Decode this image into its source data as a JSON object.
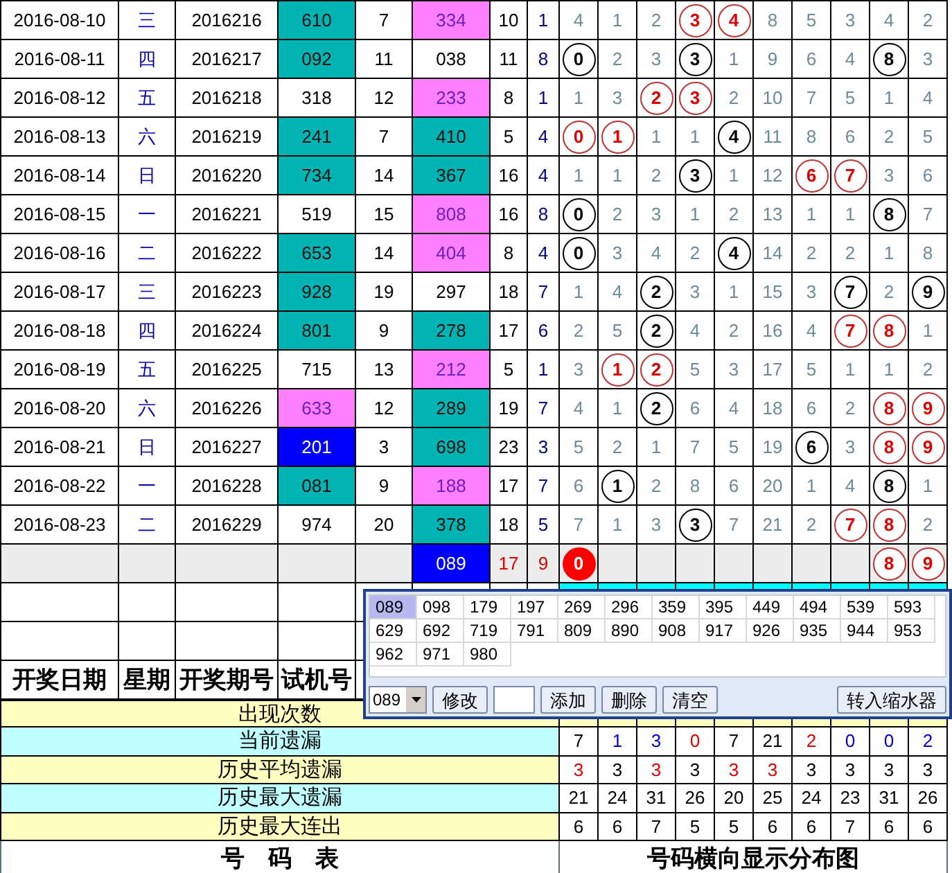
{
  "rows": [
    {
      "date": "2016-08-10",
      "weekday": "三",
      "issue": "2016216",
      "test": {
        "value": "610",
        "color": "#00b4b4"
      },
      "test_sum": "7",
      "draw": {
        "value": "334",
        "color": "#ff80ff"
      },
      "draw_sum": "10",
      "draw_tail": "1",
      "cells": [
        {
          "kind": "plain",
          "value": "4"
        },
        {
          "kind": "plain",
          "value": "1"
        },
        {
          "kind": "plain",
          "value": "2"
        },
        {
          "kind": "ring",
          "value": "3"
        },
        {
          "kind": "ring",
          "value": "4"
        },
        {
          "kind": "plain",
          "value": "8"
        },
        {
          "kind": "plain",
          "value": "5"
        },
        {
          "kind": "plain",
          "value": "3"
        },
        {
          "kind": "plain",
          "value": "4"
        },
        {
          "kind": "plain",
          "value": "2"
        }
      ]
    },
    {
      "date": "2016-08-11",
      "weekday": "四",
      "issue": "2016217",
      "test": {
        "value": "092",
        "color": "#00b4b4"
      },
      "test_sum": "11",
      "draw": {
        "value": "038"
      },
      "draw_sum": "11",
      "draw_tail": "8",
      "cells": [
        {
          "kind": "ball",
          "value": "0"
        },
        {
          "kind": "plain",
          "value": "2"
        },
        {
          "kind": "plain",
          "value": "3"
        },
        {
          "kind": "ball",
          "value": "3"
        },
        {
          "kind": "plain",
          "value": "1"
        },
        {
          "kind": "plain",
          "value": "9"
        },
        {
          "kind": "plain",
          "value": "6"
        },
        {
          "kind": "plain",
          "value": "4"
        },
        {
          "kind": "ball",
          "value": "8"
        },
        {
          "kind": "plain",
          "value": "3"
        }
      ]
    },
    {
      "date": "2016-08-12",
      "weekday": "五",
      "issue": "2016218",
      "test": {
        "value": "318"
      },
      "test_sum": "12",
      "draw": {
        "value": "233",
        "color": "#ff80ff"
      },
      "draw_sum": "8",
      "draw_tail": "1",
      "cells": [
        {
          "kind": "plain",
          "value": "1"
        },
        {
          "kind": "plain",
          "value": "3"
        },
        {
          "kind": "ring",
          "value": "2"
        },
        {
          "kind": "ring",
          "value": "3"
        },
        {
          "kind": "plain",
          "value": "2"
        },
        {
          "kind": "plain",
          "value": "10"
        },
        {
          "kind": "plain",
          "value": "7"
        },
        {
          "kind": "plain",
          "value": "5"
        },
        {
          "kind": "plain",
          "value": "1"
        },
        {
          "kind": "plain",
          "value": "4"
        }
      ]
    },
    {
      "date": "2016-08-13",
      "weekday": "六",
      "issue": "2016219",
      "test": {
        "value": "241",
        "color": "#00b4b4"
      },
      "test_sum": "7",
      "draw": {
        "value": "410",
        "color": "#00b4b4"
      },
      "draw_sum": "5",
      "draw_tail": "4",
      "cells": [
        {
          "kind": "ring",
          "value": "0"
        },
        {
          "kind": "ring",
          "value": "1"
        },
        {
          "kind": "plain",
          "value": "1"
        },
        {
          "kind": "plain",
          "value": "1"
        },
        {
          "kind": "ball",
          "value": "4"
        },
        {
          "kind": "plain",
          "value": "11"
        },
        {
          "kind": "plain",
          "value": "8"
        },
        {
          "kind": "plain",
          "value": "6"
        },
        {
          "kind": "plain",
          "value": "2"
        },
        {
          "kind": "plain",
          "value": "5"
        }
      ]
    },
    {
      "date": "2016-08-14",
      "weekday": "日",
      "issue": "2016220",
      "test": {
        "value": "734",
        "color": "#00b4b4"
      },
      "test_sum": "14",
      "draw": {
        "value": "367",
        "color": "#00b4b4"
      },
      "draw_sum": "16",
      "draw_tail": "4",
      "cells": [
        {
          "kind": "plain",
          "value": "1"
        },
        {
          "kind": "plain",
          "value": "1"
        },
        {
          "kind": "plain",
          "value": "2"
        },
        {
          "kind": "ball",
          "value": "3"
        },
        {
          "kind": "plain",
          "value": "1"
        },
        {
          "kind": "plain",
          "value": "12"
        },
        {
          "kind": "ring",
          "value": "6"
        },
        {
          "kind": "ring",
          "value": "7"
        },
        {
          "kind": "plain",
          "value": "3"
        },
        {
          "kind": "plain",
          "value": "6"
        }
      ]
    },
    {
      "date": "2016-08-15",
      "weekday": "一",
      "issue": "2016221",
      "test": {
        "value": "519"
      },
      "test_sum": "15",
      "draw": {
        "value": "808",
        "color": "#ff80ff"
      },
      "draw_sum": "16",
      "draw_tail": "8",
      "cells": [
        {
          "kind": "ball",
          "value": "0"
        },
        {
          "kind": "plain",
          "value": "2"
        },
        {
          "kind": "plain",
          "value": "3"
        },
        {
          "kind": "plain",
          "value": "1"
        },
        {
          "kind": "plain",
          "value": "2"
        },
        {
          "kind": "plain",
          "value": "13"
        },
        {
          "kind": "plain",
          "value": "1"
        },
        {
          "kind": "plain",
          "value": "1"
        },
        {
          "kind": "ball",
          "value": "8"
        },
        {
          "kind": "plain",
          "value": "7"
        }
      ]
    },
    {
      "date": "2016-08-16",
      "weekday": "二",
      "issue": "2016222",
      "test": {
        "value": "653",
        "color": "#00b4b4"
      },
      "test_sum": "14",
      "draw": {
        "value": "404",
        "color": "#ff80ff"
      },
      "draw_sum": "8",
      "draw_tail": "4",
      "cells": [
        {
          "kind": "ball",
          "value": "0"
        },
        {
          "kind": "plain",
          "value": "3"
        },
        {
          "kind": "plain",
          "value": "4"
        },
        {
          "kind": "plain",
          "value": "2"
        },
        {
          "kind": "ball",
          "value": "4"
        },
        {
          "kind": "plain",
          "value": "14"
        },
        {
          "kind": "plain",
          "value": "2"
        },
        {
          "kind": "plain",
          "value": "2"
        },
        {
          "kind": "plain",
          "value": "1"
        },
        {
          "kind": "plain",
          "value": "8"
        }
      ]
    },
    {
      "date": "2016-08-17",
      "weekday": "三",
      "issue": "2016223",
      "test": {
        "value": "928",
        "color": "#00b4b4"
      },
      "test_sum": "19",
      "draw": {
        "value": "297"
      },
      "draw_sum": "18",
      "draw_tail": "7",
      "cells": [
        {
          "kind": "plain",
          "value": "1"
        },
        {
          "kind": "plain",
          "value": "4"
        },
        {
          "kind": "ball",
          "value": "2"
        },
        {
          "kind": "plain",
          "value": "3"
        },
        {
          "kind": "plain",
          "value": "1"
        },
        {
          "kind": "plain",
          "value": "15"
        },
        {
          "kind": "plain",
          "value": "3"
        },
        {
          "kind": "ball",
          "value": "7"
        },
        {
          "kind": "plain",
          "value": "2"
        },
        {
          "kind": "ball",
          "value": "9"
        }
      ]
    },
    {
      "date": "2016-08-18",
      "weekday": "四",
      "issue": "2016224",
      "test": {
        "value": "801",
        "color": "#00b4b4"
      },
      "test_sum": "9",
      "draw": {
        "value": "278",
        "color": "#00b4b4"
      },
      "draw_sum": "17",
      "draw_tail": "6",
      "cells": [
        {
          "kind": "plain",
          "value": "2"
        },
        {
          "kind": "plain",
          "value": "5"
        },
        {
          "kind": "ball",
          "value": "2"
        },
        {
          "kind": "plain",
          "value": "4"
        },
        {
          "kind": "plain",
          "value": "2"
        },
        {
          "kind": "plain",
          "value": "16"
        },
        {
          "kind": "plain",
          "value": "4"
        },
        {
          "kind": "ring",
          "value": "7"
        },
        {
          "kind": "ring",
          "value": "8"
        },
        {
          "kind": "plain",
          "value": "1"
        }
      ]
    },
    {
      "date": "2016-08-19",
      "weekday": "五",
      "issue": "2016225",
      "test": {
        "value": "715"
      },
      "test_sum": "13",
      "draw": {
        "value": "212",
        "color": "#ff80ff"
      },
      "draw_sum": "5",
      "draw_tail": "1",
      "cells": [
        {
          "kind": "plain",
          "value": "3"
        },
        {
          "kind": "ring",
          "value": "1"
        },
        {
          "kind": "ring",
          "value": "2"
        },
        {
          "kind": "plain",
          "value": "5"
        },
        {
          "kind": "plain",
          "value": "3"
        },
        {
          "kind": "plain",
          "value": "17"
        },
        {
          "kind": "plain",
          "value": "5"
        },
        {
          "kind": "plain",
          "value": "1"
        },
        {
          "kind": "plain",
          "value": "1"
        },
        {
          "kind": "plain",
          "value": "2"
        }
      ]
    },
    {
      "date": "2016-08-20",
      "weekday": "六",
      "issue": "2016226",
      "test": {
        "value": "633",
        "color": "#ff80ff"
      },
      "test_sum": "12",
      "draw": {
        "value": "289",
        "color": "#00b4b4"
      },
      "draw_sum": "19",
      "draw_tail": "7",
      "cells": [
        {
          "kind": "plain",
          "value": "4"
        },
        {
          "kind": "plain",
          "value": "1"
        },
        {
          "kind": "ball",
          "value": "2"
        },
        {
          "kind": "plain",
          "value": "6"
        },
        {
          "kind": "plain",
          "value": "4"
        },
        {
          "kind": "plain",
          "value": "18"
        },
        {
          "kind": "plain",
          "value": "6"
        },
        {
          "kind": "plain",
          "value": "2"
        },
        {
          "kind": "ring",
          "value": "8"
        },
        {
          "kind": "ring",
          "value": "9"
        }
      ]
    },
    {
      "date": "2016-08-21",
      "weekday": "日",
      "issue": "2016227",
      "test": {
        "value": "201",
        "color": "#0000ff"
      },
      "test_sum": "3",
      "draw": {
        "value": "698",
        "color": "#00b4b4"
      },
      "draw_sum": "23",
      "draw_tail": "3",
      "cells": [
        {
          "kind": "plain",
          "value": "5"
        },
        {
          "kind": "plain",
          "value": "2"
        },
        {
          "kind": "plain",
          "value": "1"
        },
        {
          "kind": "plain",
          "value": "7"
        },
        {
          "kind": "plain",
          "value": "5"
        },
        {
          "kind": "plain",
          "value": "19"
        },
        {
          "kind": "ball",
          "value": "6"
        },
        {
          "kind": "plain",
          "value": "3"
        },
        {
          "kind": "ring",
          "value": "8"
        },
        {
          "kind": "ring",
          "value": "9"
        }
      ]
    },
    {
      "date": "2016-08-22",
      "weekday": "一",
      "issue": "2016228",
      "test": {
        "value": "081",
        "color": "#00b4b4"
      },
      "test_sum": "9",
      "draw": {
        "value": "188",
        "color": "#ff80ff"
      },
      "draw_sum": "17",
      "draw_tail": "7",
      "cells": [
        {
          "kind": "plain",
          "value": "6"
        },
        {
          "kind": "ball",
          "value": "1"
        },
        {
          "kind": "plain",
          "value": "2"
        },
        {
          "kind": "plain",
          "value": "8"
        },
        {
          "kind": "plain",
          "value": "6"
        },
        {
          "kind": "plain",
          "value": "20"
        },
        {
          "kind": "plain",
          "value": "1"
        },
        {
          "kind": "plain",
          "value": "4"
        },
        {
          "kind": "ball",
          "value": "8"
        },
        {
          "kind": "plain",
          "value": "1"
        }
      ]
    },
    {
      "date": "2016-08-23",
      "weekday": "二",
      "issue": "2016229",
      "test": {
        "value": "974"
      },
      "test_sum": "20",
      "draw": {
        "value": "378",
        "color": "#00b4b4"
      },
      "draw_sum": "18",
      "draw_tail": "5",
      "cells": [
        {
          "kind": "plain",
          "value": "7"
        },
        {
          "kind": "plain",
          "value": "1"
        },
        {
          "kind": "plain",
          "value": "3"
        },
        {
          "kind": "ball",
          "value": "3"
        },
        {
          "kind": "plain",
          "value": "7"
        },
        {
          "kind": "plain",
          "value": "21"
        },
        {
          "kind": "plain",
          "value": "2"
        },
        {
          "kind": "ring",
          "value": "7"
        },
        {
          "kind": "ring",
          "value": "8"
        },
        {
          "kind": "plain",
          "value": "2"
        }
      ]
    }
  ],
  "forecast": {
    "draw": "089",
    "draw_sum": "17",
    "draw_tail": "9",
    "cells": [
      {
        "kind": "filled",
        "value": "0"
      },
      {
        "kind": "empty"
      },
      {
        "kind": "empty"
      },
      {
        "kind": "empty"
      },
      {
        "kind": "empty"
      },
      {
        "kind": "empty"
      },
      {
        "kind": "empty"
      },
      {
        "kind": "empty"
      },
      {
        "kind": "ring",
        "value": "8"
      },
      {
        "kind": "ring",
        "value": "9"
      }
    ]
  },
  "headers": [
    "开奖日期",
    "星期",
    "开奖期号",
    "试机号"
  ],
  "stats": [
    {
      "label": "出现次数"
    },
    {
      "label": "当前遗漏",
      "values": [
        {
          "value": "7",
          "color": "#000000"
        },
        {
          "value": "1",
          "color": "#0000cc"
        },
        {
          "value": "3",
          "color": "#0000cc"
        },
        {
          "value": "0",
          "color": "#dd0000"
        },
        {
          "value": "7",
          "color": "#000000"
        },
        {
          "value": "21",
          "color": "#000000"
        },
        {
          "value": "2",
          "color": "#dd0000"
        },
        {
          "value": "0",
          "color": "#0000cc"
        },
        {
          "value": "0",
          "color": "#0000cc"
        },
        {
          "value": "2",
          "color": "#0000cc"
        }
      ]
    },
    {
      "label": "历史平均遗漏",
      "values": [
        {
          "value": "3",
          "color": "#dd0000"
        },
        {
          "value": "3",
          "color": "#000000"
        },
        {
          "value": "3",
          "color": "#dd0000"
        },
        {
          "value": "3",
          "color": "#000000"
        },
        {
          "value": "3",
          "color": "#dd0000"
        },
        {
          "value": "3",
          "color": "#dd0000"
        },
        {
          "value": "3",
          "color": "#000000"
        },
        {
          "value": "3",
          "color": "#000000"
        },
        {
          "value": "3",
          "color": "#000000"
        },
        {
          "value": "3",
          "color": "#000000"
        }
      ]
    },
    {
      "label": "历史最大遗漏",
      "values": [
        {
          "value": "21",
          "color": "#000000"
        },
        {
          "value": "24",
          "color": "#000000"
        },
        {
          "value": "31",
          "color": "#000000"
        },
        {
          "value": "26",
          "color": "#000000"
        },
        {
          "value": "20",
          "color": "#000000"
        },
        {
          "value": "25",
          "color": "#000000"
        },
        {
          "value": "24",
          "color": "#000000"
        },
        {
          "value": "23",
          "color": "#000000"
        },
        {
          "value": "31",
          "color": "#000000"
        },
        {
          "value": "26",
          "color": "#000000"
        }
      ]
    },
    {
      "label": "历史最大连出",
      "values": [
        {
          "value": "6",
          "color": "#000000"
        },
        {
          "value": "6",
          "color": "#000000"
        },
        {
          "value": "7",
          "color": "#000000"
        },
        {
          "value": "5",
          "color": "#000000"
        },
        {
          "value": "5",
          "color": "#000000"
        },
        {
          "value": "6",
          "color": "#000000"
        },
        {
          "value": "6",
          "color": "#000000"
        },
        {
          "value": "7",
          "color": "#000000"
        },
        {
          "value": "6",
          "color": "#000000"
        },
        {
          "value": "6",
          "color": "#000000"
        }
      ]
    }
  ],
  "footer": {
    "left": "号　码　表",
    "right": "号码横向显示分布图"
  },
  "popup": {
    "numbers": [
      {
        "value": "089",
        "selected": true
      },
      {
        "value": "098",
        "selected": false
      },
      {
        "value": "179",
        "selected": false
      },
      {
        "value": "197",
        "selected": false
      },
      {
        "value": "269",
        "selected": false
      },
      {
        "value": "296",
        "selected": false
      },
      {
        "value": "359",
        "selected": false
      },
      {
        "value": "395",
        "selected": false
      },
      {
        "value": "449",
        "selected": false
      },
      {
        "value": "494",
        "selected": false
      },
      {
        "value": "539",
        "selected": false
      },
      {
        "value": "593",
        "selected": false
      },
      {
        "value": "629",
        "selected": false
      },
      {
        "value": "692",
        "selected": false
      },
      {
        "value": "719",
        "selected": false
      },
      {
        "value": "791",
        "selected": false
      },
      {
        "value": "809",
        "selected": false
      },
      {
        "value": "890",
        "selected": false
      },
      {
        "value": "908",
        "selected": false
      },
      {
        "value": "917",
        "selected": false
      },
      {
        "value": "926",
        "selected": false
      },
      {
        "value": "935",
        "selected": false
      },
      {
        "value": "944",
        "selected": false
      },
      {
        "value": "953",
        "selected": false
      },
      {
        "value": "962",
        "selected": false
      },
      {
        "value": "971",
        "selected": false
      },
      {
        "value": "980",
        "selected": false
      }
    ],
    "dropdown": "089",
    "buttons": [
      "修改",
      "添加",
      "删除",
      "清空"
    ],
    "transfer_button": "转入缩水器"
  }
}
